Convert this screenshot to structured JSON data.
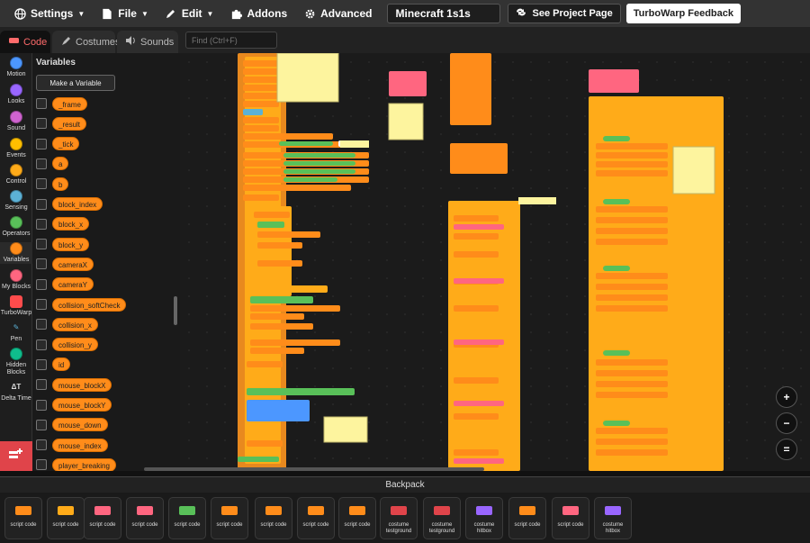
{
  "menubar": {
    "settings": "Settings",
    "file": "File",
    "edit": "Edit",
    "addons": "Addons",
    "advanced": "Advanced",
    "project_title": "Minecraft 1s1s",
    "see_project": "See Project Page",
    "feedback": "TurboWarp Feedback"
  },
  "tabs": {
    "code": "Code",
    "costumes": "Costumes",
    "sounds": "Sounds"
  },
  "find": {
    "placeholder": "Find (Ctrl+F)"
  },
  "categories": [
    {
      "label": "Motion",
      "color": "#4c97ff"
    },
    {
      "label": "Looks",
      "color": "#9966ff"
    },
    {
      "label": "Sound",
      "color": "#cf63cf"
    },
    {
      "label": "Events",
      "color": "#ffbf00"
    },
    {
      "label": "Control",
      "color": "#ffab19"
    },
    {
      "label": "Sensing",
      "color": "#5cb1d6"
    },
    {
      "label": "Operators",
      "color": "#59c059"
    },
    {
      "label": "Variables",
      "color": "#ff8c1a"
    },
    {
      "label": "My Blocks",
      "color": "#ff6680"
    },
    {
      "label": "TurboWarp",
      "color": "#ff4c4c"
    },
    {
      "label": "Pen",
      "color": "#0fbd8c"
    },
    {
      "label": "Hidden Blocks",
      "color": "#0fbd8c"
    },
    {
      "label": "Delta Time",
      "color": "#777777"
    }
  ],
  "palette": {
    "title": "Variables",
    "make_variable": "Make a Variable",
    "variables": [
      "_frame",
      "_result",
      "_tick",
      "a",
      "b",
      "block_index",
      "block_x",
      "block_y",
      "cameraX",
      "cameraY",
      "collision_softCheck",
      "collision_x",
      "collision_y",
      "id",
      "mouse_blockX",
      "mouse_blockY",
      "mouse_down",
      "mouse_index",
      "player_breaking"
    ]
  },
  "zoom": {
    "in": "+",
    "out": "−",
    "reset": "="
  },
  "backpack": {
    "title": "Backpack",
    "items": [
      {
        "label": "script code",
        "thumb": "#ff8c1a"
      },
      {
        "label": "script code",
        "thumb": "#ffab19"
      },
      {
        "label": "script code",
        "thumb": "#ff6680"
      },
      {
        "label": "script code",
        "thumb": "#ff6680"
      },
      {
        "label": "script code",
        "thumb": "#59c059"
      },
      {
        "label": "script code",
        "thumb": "#ff8c1a"
      },
      {
        "label": "script code",
        "thumb": "#ff8c1a"
      },
      {
        "label": "script code",
        "thumb": "#ff8c1a"
      },
      {
        "label": "script code",
        "thumb": "#ff8c1a"
      },
      {
        "label": "costume testground",
        "thumb": "#e0444a"
      },
      {
        "label": "costume testground",
        "thumb": "#e0444a"
      },
      {
        "label": "costume hitbox",
        "thumb": "#9966ff"
      },
      {
        "label": "script code",
        "thumb": "#ff8c1a"
      },
      {
        "label": "script code",
        "thumb": "#ff6680"
      },
      {
        "label": "costume hitbox",
        "thumb": "#9966ff"
      }
    ]
  }
}
